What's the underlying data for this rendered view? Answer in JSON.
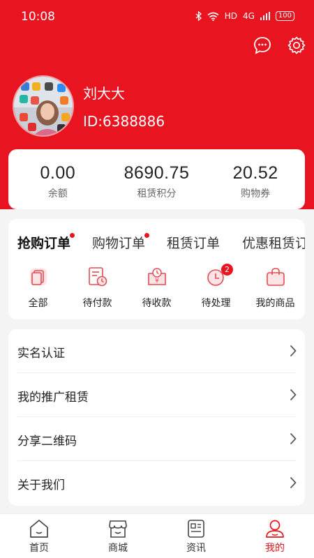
{
  "status_bar": {
    "time": "10:08",
    "network": "HD",
    "signal": "4G",
    "battery": "100"
  },
  "header": {
    "message_icon": "message-icon",
    "settings_icon": "gear-icon"
  },
  "user": {
    "name": "刘大大",
    "id": "ID:6388886"
  },
  "stats": [
    {
      "value": "0.00",
      "label": "余额"
    },
    {
      "value": "8690.75",
      "label": "租赁积分"
    },
    {
      "value": "20.52",
      "label": "购物券"
    }
  ],
  "order_tabs": [
    {
      "label": "抢购订单",
      "active": true,
      "dot": true
    },
    {
      "label": "购物订单",
      "active": false,
      "dot": true
    },
    {
      "label": "租赁订单",
      "active": false,
      "dot": false
    },
    {
      "label": "优惠租赁订",
      "active": false,
      "dot": false
    }
  ],
  "order_icons": [
    {
      "label": "全部",
      "icon": "all-orders-icon"
    },
    {
      "label": "待付款",
      "icon": "pending-payment-icon"
    },
    {
      "label": "待收款",
      "icon": "pending-receipt-icon"
    },
    {
      "label": "待处理",
      "icon": "pending-process-icon",
      "badge": "2"
    },
    {
      "label": "我的商品",
      "icon": "shopping-bag-icon"
    }
  ],
  "menu": [
    {
      "label": "实名认证"
    },
    {
      "label": "我的推广租赁"
    },
    {
      "label": "分享二维码"
    },
    {
      "label": "关于我们"
    }
  ],
  "bottom_nav": [
    {
      "label": "首页",
      "icon": "home-icon",
      "active": false
    },
    {
      "label": "商城",
      "icon": "store-icon",
      "active": false
    },
    {
      "label": "资讯",
      "icon": "news-icon",
      "active": false
    },
    {
      "label": "我的",
      "icon": "profile-icon",
      "active": true
    }
  ],
  "colors": {
    "accent": "#e8141f",
    "background": "#f4f4f4",
    "icon_red": "#e34b52"
  }
}
